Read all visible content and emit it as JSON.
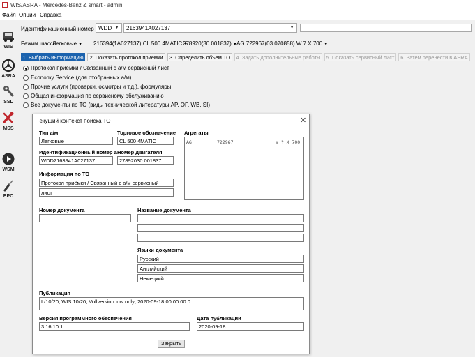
{
  "window": {
    "title": "WIS/ASRA - Mercedes-Benz & smart - admin"
  },
  "menu": [
    "Файл",
    "Опции",
    "Справка"
  ],
  "leftnav": [
    {
      "label": "WIS",
      "icon": "car-icon"
    },
    {
      "label": "ASRA",
      "icon": "steering-wheel-icon"
    },
    {
      "label": "SSL",
      "icon": "wrench-icon"
    },
    {
      "label": "MSS",
      "icon": "tools-icon"
    },
    {
      "label": "WSM",
      "icon": "play-icon"
    },
    {
      "label": "EPC",
      "icon": "screwdriver-icon"
    }
  ],
  "vin": {
    "label": "Идентификационный номер а/м",
    "prefix": "WDD",
    "value": "2163941A027137"
  },
  "chassis": {
    "mode_label": "Режим шасси",
    "items": [
      "Легковые",
      "216394(1A027137) CL 500 4MATIC",
      "278920(30 001837)",
      "AG 722967(03 070858) W 7 X 700"
    ]
  },
  "steps": [
    {
      "label": "1. Выбрать информацию",
      "state": "active"
    },
    {
      "label": "2. Показать протокол приёмки",
      "state": "normal"
    },
    {
      "label": "3. Определить объём ТО",
      "state": "normal"
    },
    {
      "label": "4. Задать дополнительные работы",
      "state": "disabled"
    },
    {
      "label": "5. Показать сервисный лист",
      "state": "disabled"
    },
    {
      "label": "6. Затем перенести в ASRA",
      "state": "disabled"
    }
  ],
  "options": [
    {
      "label": "Протокол приёмки / Связанный с а/м сервисный лист",
      "selected": true
    },
    {
      "label": "Economy Service (для отобранных а/м)",
      "selected": false
    },
    {
      "label": "Прочие услуги (проверки, осмотры и т.д.), формуляры",
      "selected": false
    },
    {
      "label": "Общая информация по сервисному обслуживанию",
      "selected": false
    },
    {
      "label": "Все документы по ТО (виды технической литературы AP, OF, WB, SI)",
      "selected": false
    }
  ],
  "dialog": {
    "title": "Текущий контекст поиска ТО",
    "vehicle_type_label": "Тип а/м",
    "vehicle_type": "Легковые",
    "trade_name_label": "Торговое обозначение",
    "trade_name": "CL 500 4MATIC",
    "vin_label": "Идентификационный номер а/м",
    "vin": "WDD2163941A027137",
    "engine_label": "Номер двигателя",
    "engine": "27892030 001837",
    "units_label": "Агрегаты",
    "units": [
      {
        "type": "AG",
        "code": "722967",
        "desc": "W ? X 700"
      }
    ],
    "to_info_label": "Информация по ТО",
    "to_info_1": "Протокол приёмки / Связанный с а/м сервисный",
    "to_info_2": "лист",
    "doc_number_label": "Номер документа",
    "doc_number": "",
    "doc_name_label": "Название документа",
    "doc_names": [
      "",
      "",
      ""
    ],
    "languages_label": "Языки документа",
    "languages": [
      "Русский",
      "Английский",
      "Немецкий"
    ],
    "publication_label": "Публикация",
    "publication": "L/10/20; WIS 10/20, Vollversion low only; 2020-09-18 00:00:00.0",
    "sw_version_label": "Версия программного обеспечения",
    "sw_version": "3.16.10.1",
    "pub_date_label": "Дата публикации",
    "pub_date": "2020-09-18",
    "close_label": "Закрыть",
    "close_icon": "close-icon"
  },
  "colors": {
    "active_step": "#1c63ae",
    "mss_icon": "#c0262d"
  }
}
